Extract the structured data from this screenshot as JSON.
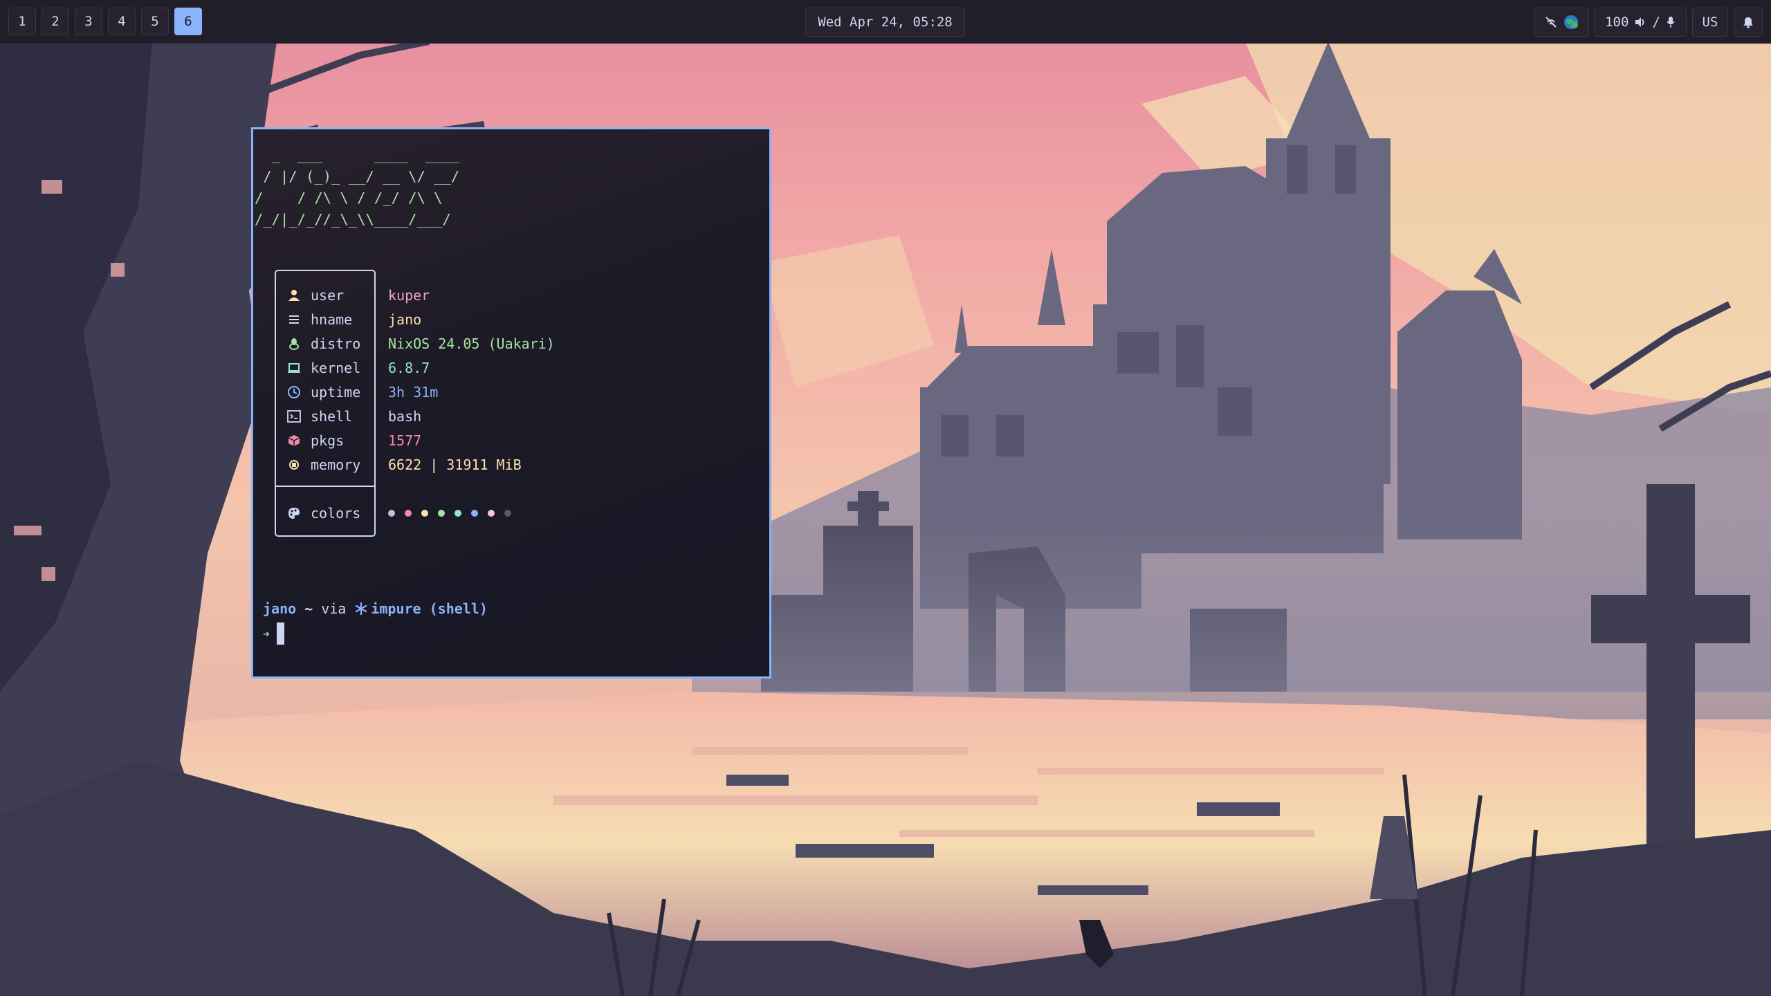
{
  "topbar": {
    "workspaces": [
      {
        "label": "1",
        "active": false
      },
      {
        "label": "2",
        "active": false
      },
      {
        "label": "3",
        "active": false
      },
      {
        "label": "4",
        "active": false
      },
      {
        "label": "5",
        "active": false
      },
      {
        "label": "6",
        "active": true
      }
    ],
    "clock": "Wed Apr 24, 05:28",
    "network": {
      "icon": "network-disconnected-icon",
      "badge_icon": "vpn-globe-icon"
    },
    "audio": {
      "volume": "100",
      "volume_icon": "speaker-icon",
      "separator": "/",
      "mic_icon": "microphone-icon"
    },
    "keyboard_layout": "US",
    "notification_icon": "bell-icon"
  },
  "terminal": {
    "ascii_logo": [
      "  _  ___      ____  ____",
      " / |/ (_)_ __/ __ \\/ __/",
      "/    / /\\ \\ / /_/ /\\ \\",
      "/_/|_/_//_\\_\\\\____/___/"
    ],
    "info": [
      {
        "icon": "user-icon",
        "key": "user",
        "value": "kuper",
        "color": "#f2a6c1"
      },
      {
        "icon": "hostname-icon",
        "key": "hname",
        "value": "jano",
        "color": "#f9e2af"
      },
      {
        "icon": "linux-icon",
        "key": "distro",
        "value": "NixOS 24.05 (Uakari)",
        "color": "#a6e3a1"
      },
      {
        "icon": "laptop-icon",
        "key": "kernel",
        "value": "6.8.7",
        "color": "#94e2d5"
      },
      {
        "icon": "clock-icon",
        "key": "uptime",
        "value": "3h 31m",
        "color": "#89b4fa"
      },
      {
        "icon": "terminal-icon",
        "key": "shell",
        "value": "bash",
        "color": "#cdd6f4"
      },
      {
        "icon": "package-icon",
        "key": "pkgs",
        "value": "1577",
        "color": "#f38ba8"
      },
      {
        "icon": "memory-icon",
        "key": "memory",
        "value": "6622 | 31911 MiB",
        "color": "#f9e2af"
      }
    ],
    "colors_row": {
      "icon": "palette-icon",
      "key": "colors",
      "swatches": [
        "#bac2de",
        "#f38ba8",
        "#f9e2af",
        "#a6e3a1",
        "#94e2d5",
        "#89b4fa",
        "#f5c2e7",
        "#585b70"
      ]
    },
    "prompt": {
      "host": "jano",
      "path": "~",
      "via": "via",
      "nix_icon": "nix-snowflake-icon",
      "env": "impure (shell)",
      "arrow": "➜"
    }
  },
  "colors": {
    "accent": "#89b4fa",
    "bar_bg": "#201e29",
    "text": "#cdd6f4"
  }
}
